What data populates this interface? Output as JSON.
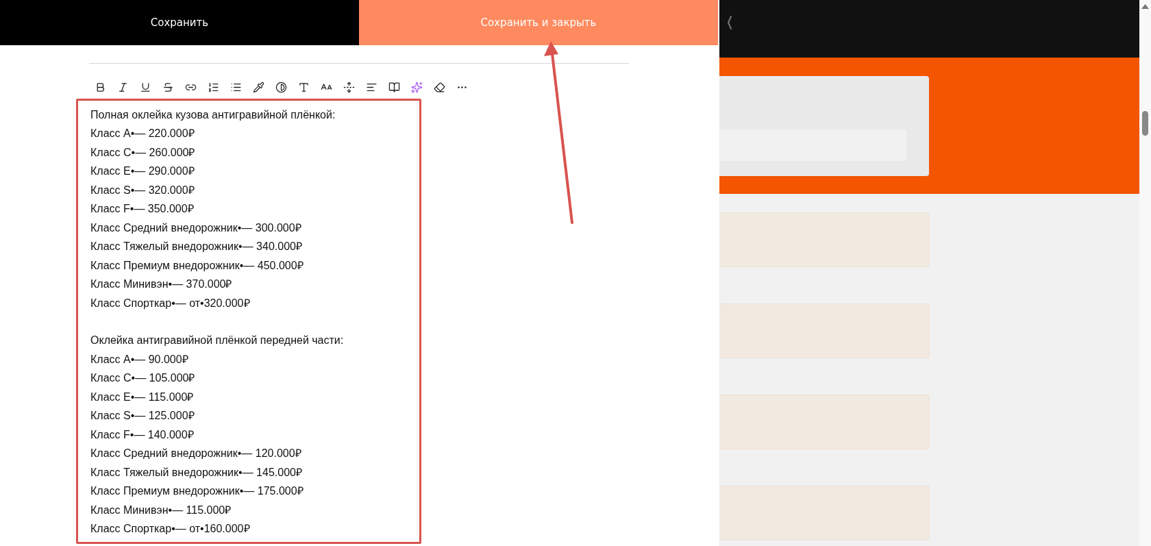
{
  "header": {
    "buttons": [
      {
        "label": "Сохранить",
        "kind": "dark"
      },
      {
        "label": "Сохранить и закрыть",
        "kind": "accent"
      }
    ]
  },
  "editor": {
    "sections": [
      {
        "heading": "Полная оклейка кузова антигравийной плёнкой:",
        "lines": [
          "Класс A•— 220.000₽",
          "Класс C•— 260.000₽",
          "Класс E•— 290.000₽",
          "Класс S•— 320.000₽",
          "Класс F•— 350.000₽",
          "Класс Средний внедорожник•— 300.000₽",
          "Класс Тяжелый внедорожник•— 340.000₽",
          "Класс Премиум внедорожник•— 450.000₽",
          "Класс Минивэн•— 370.000₽",
          "Класс Спорткар•— от•320.000₽"
        ]
      },
      {
        "heading": "Оклейка антигравийной плёнкой передней части:",
        "lines": [
          "Класс A•— 90.000₽",
          "Класс C•— 105.000₽",
          "Класс E•— 115.000₽",
          "Класс S•— 125.000₽",
          "Класс F•— 140.000₽",
          "Класс Средний внедорожник•— 120.000₽",
          "Класс Тяжелый внедорожник•— 145.000₽",
          "Класс Премиум внедорожник•— 175.000₽",
          "Класс Минивэн•— 115.000₽",
          "Класс Спорткар•— от•160.000₽"
        ]
      }
    ]
  }
}
